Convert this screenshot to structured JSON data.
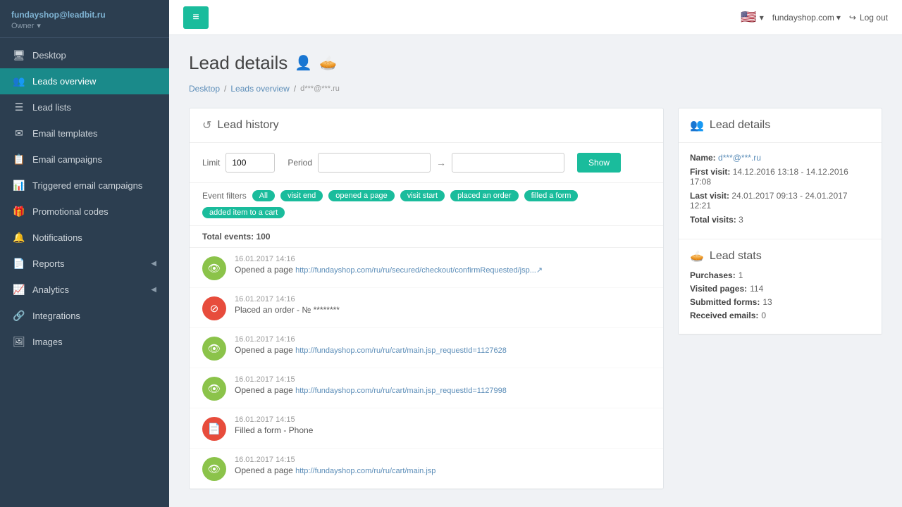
{
  "sidebar": {
    "user_email": "fundayshop@leadbit.ru",
    "user_role": "Owner",
    "items": [
      {
        "id": "desktop",
        "label": "Desktop",
        "icon": "🖥",
        "active": false
      },
      {
        "id": "leads-overview",
        "label": "Leads overview",
        "icon": "👥",
        "active": true
      },
      {
        "id": "lead-lists",
        "label": "Lead lists",
        "icon": "☰",
        "active": false
      },
      {
        "id": "email-templates",
        "label": "Email templates",
        "icon": "✉",
        "active": false
      },
      {
        "id": "email-campaigns",
        "label": "Email campaigns",
        "icon": "📋",
        "active": false
      },
      {
        "id": "triggered-email",
        "label": "Triggered email campaigns",
        "icon": "📊",
        "active": false
      },
      {
        "id": "promo-codes",
        "label": "Promotional codes",
        "icon": "🎁",
        "active": false
      },
      {
        "id": "notifications",
        "label": "Notifications",
        "icon": "🔔",
        "active": false
      },
      {
        "id": "reports",
        "label": "Reports",
        "icon": "📄",
        "active": false,
        "has_arrow": true
      },
      {
        "id": "analytics",
        "label": "Analytics",
        "icon": "📈",
        "active": false,
        "has_arrow": true
      },
      {
        "id": "integrations",
        "label": "Integrations",
        "icon": "🔗",
        "active": false
      },
      {
        "id": "images",
        "label": "Images",
        "icon": "🖼",
        "active": false
      }
    ]
  },
  "topbar": {
    "hamburger_label": "≡",
    "flag": "🇺🇸",
    "domain": "fundayshop.com",
    "logout_label": "Log out"
  },
  "page": {
    "title": "Lead details",
    "breadcrumb": {
      "home": "Desktop",
      "section": "Leads overview",
      "current": "d***@***.ru"
    }
  },
  "lead_history": {
    "section_title": "Lead history",
    "filters": {
      "limit_label": "Limit",
      "limit_value": "100",
      "period_label": "Period",
      "period_placeholder": "",
      "show_button": "Show"
    },
    "event_filters_label": "Event filters",
    "event_tags": [
      "All",
      "visit end",
      "opened a page",
      "visit start",
      "placed an order",
      "filled a form",
      "added item to a cart"
    ],
    "total_events_label": "Total events:",
    "total_events_value": "100",
    "events": [
      {
        "time": "16.01.2017 14:16",
        "type": "opened-page",
        "icon_type": "green",
        "text": "Opened a page",
        "link": "http://fundayshop.com/ru/ru/secured/checkout/confirmRequested/jsp...↗"
      },
      {
        "time": "16.01.2017 14:16",
        "type": "placed-order",
        "icon_type": "red",
        "text": "Placed an order - № ********",
        "link": ""
      },
      {
        "time": "16.01.2017 14:16",
        "type": "opened-page",
        "icon_type": "green",
        "text": "Opened a page",
        "link": "http://fundayshop.com/ru/ru/cart/main.jsp_requestId=1127628"
      },
      {
        "time": "16.01.2017 14:15",
        "type": "opened-page",
        "icon_type": "green",
        "text": "Opened a page",
        "link": "http://fundayshop.com/ru/ru/cart/main.jsp_requestId=1127998"
      },
      {
        "time": "16.01.2017 14:15",
        "type": "filled-form",
        "icon_type": "red-doc",
        "text": "Filled a form - Phone",
        "link": ""
      },
      {
        "time": "16.01.2017 14:15",
        "type": "opened-page",
        "icon_type": "green",
        "text": "Opened a page",
        "link": "http://fundayshop.com/ru/ru/cart/main.jsp"
      }
    ]
  },
  "lead_details": {
    "section_title": "Lead details",
    "name_label": "Name:",
    "name_value": "d***@***.ru",
    "first_visit_label": "First visit:",
    "first_visit_value": "14.12.2016 13:18 - 14.12.2016 17:08",
    "last_visit_label": "Last visit:",
    "last_visit_value": "24.01.2017 09:13 - 24.01.2017 12:21",
    "total_visits_label": "Total visits:",
    "total_visits_value": "3",
    "stats_title": "Lead stats",
    "stats": [
      {
        "key": "Purchases:",
        "value": "1"
      },
      {
        "key": "Visited pages:",
        "value": "114"
      },
      {
        "key": "Submitted forms:",
        "value": "13"
      },
      {
        "key": "Received emails:",
        "value": "0"
      }
    ]
  }
}
